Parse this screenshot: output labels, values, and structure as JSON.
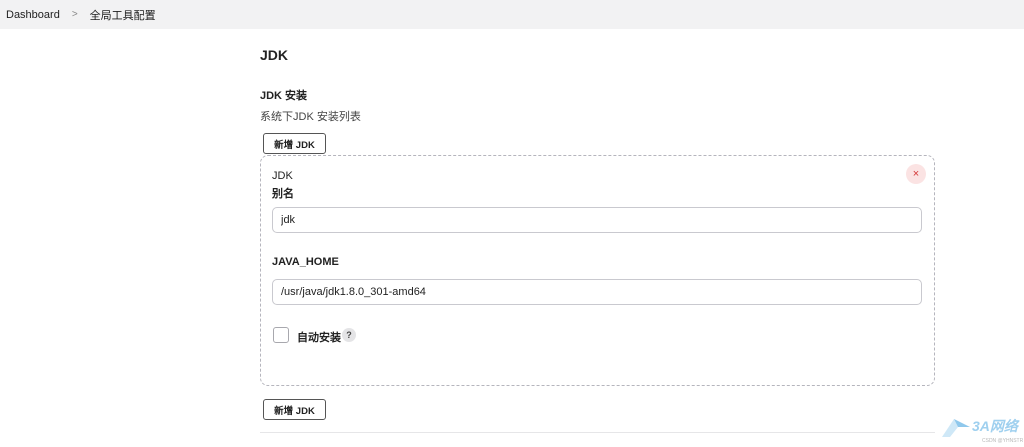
{
  "breadcrumb": {
    "root": "Dashboard",
    "separator": ">",
    "current": "全局工具配置"
  },
  "section": {
    "title": "JDK",
    "subtitle": "JDK 安装",
    "description": "系统下JDK 安装列表"
  },
  "buttons": {
    "add_top": "新增 JDK",
    "add_bottom": "新增 JDK"
  },
  "jdk_item": {
    "heading": "JDK",
    "close_label": "×",
    "alias_label": "别名",
    "alias_value": "jdk",
    "java_home_label": "JAVA_HOME",
    "java_home_value": "/usr/java/jdk1.8.0_301-amd64",
    "auto_install_label": "自动安装",
    "auto_install_checked": false,
    "help_label": "?"
  },
  "watermark": {
    "logo_text": "3A网络",
    "sub_text": "CSDN @YHNSTR"
  },
  "colors": {
    "topbar_bg": "#f2f2f3",
    "close_bg": "#fbe3e3",
    "close_fg": "#d43535"
  }
}
